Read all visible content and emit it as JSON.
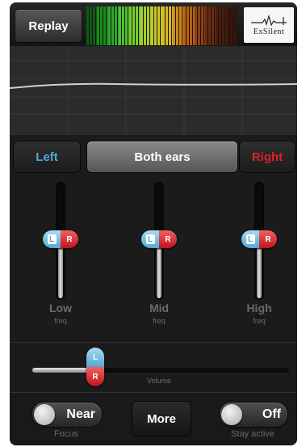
{
  "header": {
    "replay_label": "Replay",
    "brand": "ExSilent",
    "meter_colors": [
      "#0f5a14",
      "#1a8a1a",
      "#2aa82a",
      "#4ec032",
      "#78cc30",
      "#a4cc2a",
      "#c8c828",
      "#d8b820",
      "#cf8a1a",
      "#b86010",
      "#904010",
      "#6a2a10",
      "#4a1c0c",
      "#3a1408"
    ]
  },
  "ear_select": {
    "left_label": "Left",
    "both_label": "Both ears",
    "right_label": "Right",
    "selected": "Both ears"
  },
  "sliders": [
    {
      "label": "Low",
      "sub": "freq",
      "l": "L",
      "r": "R",
      "level": 0.5
    },
    {
      "label": "Mid",
      "sub": "freq",
      "l": "L",
      "r": "R",
      "level": 0.5
    },
    {
      "label": "High",
      "sub": "freq",
      "l": "L",
      "r": "R",
      "level": 0.5
    }
  ],
  "volume": {
    "label": "Volume",
    "l": "L",
    "r": "R",
    "level": 0.25
  },
  "bottom": {
    "focus_toggle_text": "Near",
    "focus_label": "Focus",
    "more_label": "More",
    "stay_toggle_text": "Off",
    "stay_label": "Stay active"
  }
}
